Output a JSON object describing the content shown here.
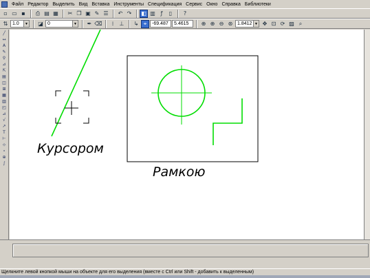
{
  "menu": {
    "items": [
      "Файл",
      "Редактор",
      "Выделить",
      "Вид",
      "Вставка",
      "Инструменты",
      "Спецификация",
      "Сервис",
      "Окно",
      "Справка",
      "Библиотеки"
    ]
  },
  "toolbar1": {
    "icons": [
      "new-document-icon",
      "open-icon",
      "save-icon",
      "print-icon",
      "print-preview-icon",
      "preview-icon",
      "cut-icon",
      "copy-icon",
      "paste-icon",
      "format-painter-icon",
      "properties-icon",
      "undo-icon",
      "redo-icon",
      "manager-icon",
      "library-icon",
      "variables-icon",
      "ruler-icon",
      "help-cursor-icon"
    ]
  },
  "toolbar2": {
    "line_width": "1.0",
    "layer": "0",
    "coord_x": "-69.487",
    "coord_y": "5.4615",
    "zoom": "1.8412"
  },
  "drawing": {
    "caption_cursor": "Курсором",
    "caption_frame": "Рамкою",
    "accent_color": "#00dd00"
  },
  "status": {
    "hint": "Щелкните левой кнопкой мыши на объекте для его выделения (вместе с Ctrl или Shift - добавить к выделенным)"
  }
}
